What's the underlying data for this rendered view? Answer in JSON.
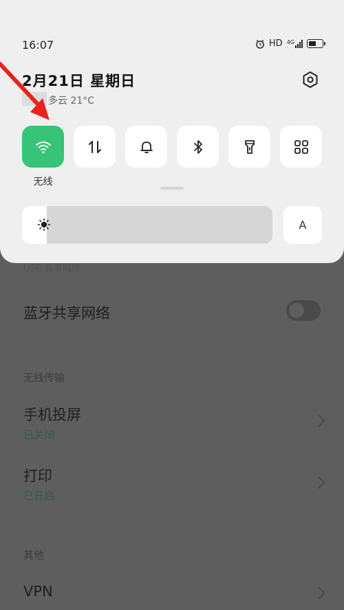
{
  "status_bar": {
    "time": "16:07",
    "hd_label": "HD",
    "network_label": "4G"
  },
  "header": {
    "date": "2月21日  星期日",
    "weather": "多云 21°C"
  },
  "quick_tiles": [
    {
      "id": "wifi",
      "label": "无线",
      "active": true,
      "icon": "wifi-icon"
    },
    {
      "id": "data",
      "active": false,
      "icon": "mobile-data-icon"
    },
    {
      "id": "bell",
      "active": false,
      "icon": "bell-icon"
    },
    {
      "id": "bluetooth",
      "active": false,
      "icon": "bluetooth-icon"
    },
    {
      "id": "flashlight",
      "active": false,
      "icon": "flashlight-icon"
    },
    {
      "id": "more",
      "active": false,
      "icon": "grid-icon"
    }
  ],
  "brightness": {
    "level": 0.1,
    "auto_label": "A"
  },
  "background": {
    "usb_section": "USB 共享网络",
    "bluetooth_share": "蓝牙共享网络",
    "wireless_section": "无线传输",
    "screen_cast": {
      "title": "手机投屏",
      "status": "已关闭"
    },
    "print": {
      "title": "打印",
      "status": "已开启"
    },
    "other_section": "其他",
    "vpn": "VPN"
  },
  "colors": {
    "accent": "#37c478",
    "panel": "#efefef",
    "arrow": "#e8231c"
  }
}
